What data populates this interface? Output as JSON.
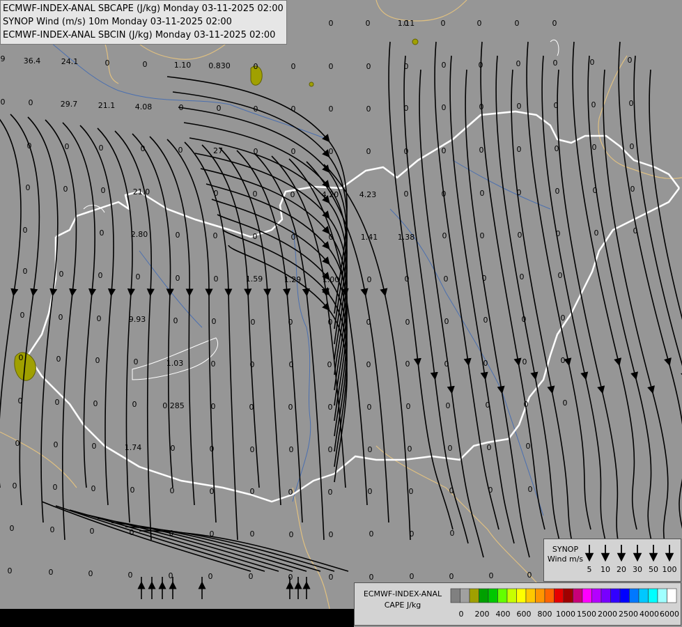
{
  "header": {
    "line1": "ECMWF-INDEX-ANAL SBCAPE (J/kg) Monday 03-11-2025 02:00",
    "line2": "SYNOP Wind (m/s) 10m Monday 03-11-2025 02:00",
    "line3": "ECMWF-INDEX-ANAL SBCIN (J/kg) Monday 03-11-2025 02:00"
  },
  "colors": {
    "background": "#969696",
    "border": "#ffffff",
    "rivers": "#4a6fb0",
    "coast": "#e0c080",
    "streamline": "#000000",
    "cape_patch": "#a0a000"
  },
  "values": [
    {
      "t": "0"
    },
    {
      "t": "0"
    },
    {
      "t": "0"
    },
    {
      "t": "0"
    },
    {
      "t": "1.11"
    },
    {
      "t": "0"
    },
    {
      "t": "0"
    },
    {
      "t": "0"
    },
    {
      "t": "0"
    },
    {
      "t": "9"
    },
    {
      "t": "36.4"
    },
    {
      "t": "24.1"
    },
    {
      "t": "0"
    },
    {
      "t": "0"
    },
    {
      "t": "1.10"
    },
    {
      "t": "0.830"
    },
    {
      "t": "0"
    },
    {
      "t": "0"
    },
    {
      "t": "0"
    },
    {
      "t": "0"
    },
    {
      "t": "0"
    },
    {
      "t": "0"
    },
    {
      "t": "0"
    },
    {
      "t": "0"
    },
    {
      "t": "0"
    },
    {
      "t": "0"
    },
    {
      "t": "0"
    },
    {
      "t": "0"
    },
    {
      "t": "0"
    },
    {
      "t": "29.7"
    },
    {
      "t": "21.1"
    },
    {
      "t": "4.08"
    },
    {
      "t": "0"
    },
    {
      "t": "0"
    },
    {
      "t": "0"
    },
    {
      "t": "0"
    },
    {
      "t": "0"
    },
    {
      "t": "0"
    },
    {
      "t": "0"
    },
    {
      "t": "0"
    },
    {
      "t": "0"
    },
    {
      "t": "0"
    },
    {
      "t": "0"
    },
    {
      "t": "0"
    },
    {
      "t": "0"
    },
    {
      "t": "0"
    },
    {
      "t": "0"
    },
    {
      "t": "0"
    },
    {
      "t": "0"
    },
    {
      "t": "0"
    },
    {
      "t": "27"
    },
    {
      "t": "0"
    },
    {
      "t": "0"
    },
    {
      "t": "0"
    },
    {
      "t": "0"
    },
    {
      "t": "0"
    },
    {
      "t": "0"
    },
    {
      "t": "0"
    },
    {
      "t": "0"
    },
    {
      "t": "0"
    },
    {
      "t": "0"
    },
    {
      "t": "0"
    },
    {
      "t": "0"
    },
    {
      "t": "0"
    },
    {
      "t": "0"
    },
    {
      "t": "21.0"
    },
    {
      "t": "0"
    },
    {
      "t": "0"
    },
    {
      "t": "0"
    },
    {
      "t": "4.20"
    },
    {
      "t": "4.23"
    },
    {
      "t": "0"
    },
    {
      "t": "0"
    },
    {
      "t": "0"
    },
    {
      "t": "0"
    },
    {
      "t": "0"
    },
    {
      "t": "0"
    },
    {
      "t": "0"
    },
    {
      "t": "0"
    },
    {
      "t": "0"
    },
    {
      "t": "2.80"
    },
    {
      "t": "0"
    },
    {
      "t": "0"
    },
    {
      "t": "0"
    },
    {
      "t": "0"
    },
    {
      "t": "0"
    },
    {
      "t": "1.41"
    },
    {
      "t": "1.38"
    },
    {
      "t": "0"
    },
    {
      "t": "0"
    },
    {
      "t": "0"
    },
    {
      "t": "0"
    },
    {
      "t": "0"
    },
    {
      "t": "0"
    },
    {
      "t": "0"
    },
    {
      "t": "0"
    },
    {
      "t": "0"
    },
    {
      "t": "0"
    },
    {
      "t": "0"
    },
    {
      "t": "0"
    },
    {
      "t": "1.59"
    },
    {
      "t": "1.29"
    },
    {
      "t": "1.00"
    },
    {
      "t": "0"
    },
    {
      "t": "0"
    },
    {
      "t": "0"
    },
    {
      "t": "0"
    },
    {
      "t": "0"
    },
    {
      "t": "0"
    },
    {
      "t": "0"
    },
    {
      "t": "0"
    },
    {
      "t": "0"
    },
    {
      "t": "9.93"
    },
    {
      "t": "0"
    },
    {
      "t": "0"
    },
    {
      "t": "0"
    },
    {
      "t": "0"
    },
    {
      "t": "0"
    },
    {
      "t": "0"
    },
    {
      "t": "0"
    },
    {
      "t": "0"
    },
    {
      "t": "0"
    },
    {
      "t": "0"
    },
    {
      "t": "0"
    },
    {
      "t": "0"
    },
    {
      "t": "0"
    },
    {
      "t": "0"
    },
    {
      "t": "0"
    },
    {
      "t": "1.03"
    },
    {
      "t": "0"
    },
    {
      "t": "0"
    },
    {
      "t": "0"
    },
    {
      "t": "0"
    },
    {
      "t": "0"
    },
    {
      "t": "0"
    },
    {
      "t": "0"
    },
    {
      "t": "0"
    },
    {
      "t": "0"
    },
    {
      "t": "0"
    },
    {
      "t": "0"
    },
    {
      "t": "0"
    },
    {
      "t": "0"
    },
    {
      "t": "0"
    },
    {
      "t": "0.285"
    },
    {
      "t": "0"
    },
    {
      "t": "0"
    },
    {
      "t": "0"
    },
    {
      "t": "0"
    },
    {
      "t": "0"
    },
    {
      "t": "0"
    },
    {
      "t": "0"
    },
    {
      "t": "0"
    },
    {
      "t": "0"
    },
    {
      "t": "0"
    },
    {
      "t": "0"
    },
    {
      "t": "0"
    },
    {
      "t": "0"
    },
    {
      "t": "1.74"
    },
    {
      "t": "0"
    },
    {
      "t": "0"
    },
    {
      "t": "0"
    },
    {
      "t": "0"
    },
    {
      "t": "0"
    },
    {
      "t": "0"
    },
    {
      "t": "0"
    },
    {
      "t": "0"
    },
    {
      "t": "0"
    },
    {
      "t": "0"
    },
    {
      "t": "0"
    },
    {
      "t": "0"
    },
    {
      "t": "0"
    },
    {
      "t": "0"
    },
    {
      "t": "0"
    },
    {
      "t": "0"
    },
    {
      "t": "0"
    },
    {
      "t": "0"
    },
    {
      "t": "0"
    },
    {
      "t": "0"
    },
    {
      "t": "0"
    },
    {
      "t": "0"
    },
    {
      "t": "0"
    },
    {
      "t": "0"
    },
    {
      "t": "0"
    },
    {
      "t": "0"
    },
    {
      "t": "0"
    },
    {
      "t": "0"
    },
    {
      "t": "0"
    },
    {
      "t": "0"
    },
    {
      "t": "0"
    },
    {
      "t": "0"
    },
    {
      "t": "0"
    },
    {
      "t": "0"
    },
    {
      "t": "0"
    },
    {
      "t": "0"
    },
    {
      "t": "0"
    },
    {
      "t": "0"
    },
    {
      "t": "0"
    },
    {
      "t": "0"
    },
    {
      "t": "0"
    },
    {
      "t": "0"
    },
    {
      "t": "0"
    },
    {
      "t": "0"
    },
    {
      "t": "0"
    },
    {
      "t": "0"
    },
    {
      "t": "0"
    },
    {
      "t": "0"
    },
    {
      "t": "0"
    },
    {
      "t": "0"
    },
    {
      "t": "0"
    },
    {
      "t": "0"
    },
    {
      "t": "0"
    }
  ],
  "synop_legend": {
    "title": "SYNOP Wind m/s",
    "speeds": [
      "5",
      "10",
      "20",
      "30",
      "50",
      "100"
    ]
  },
  "cape_legend": {
    "title": "ECMWF-INDEX-ANAL CAPE J/kg",
    "swatches": [
      "#808080",
      "#a0a0a0",
      "#a0a000",
      "#00a000",
      "#00c800",
      "#64ff00",
      "#c8ff00",
      "#ffff00",
      "#ffc800",
      "#ff9600",
      "#ff6400",
      "#e60000",
      "#a00000",
      "#c80078",
      "#ff00ff",
      "#b400ff",
      "#7800ff",
      "#3200ff",
      "#0000ff",
      "#0078ff",
      "#00c8ff",
      "#00ffff",
      "#a0ffff",
      "#ffffff"
    ],
    "ticks": [
      "0",
      "200",
      "400",
      "600",
      "800",
      "1000",
      "1500",
      "2000",
      "2500",
      "4000",
      "6000"
    ]
  }
}
